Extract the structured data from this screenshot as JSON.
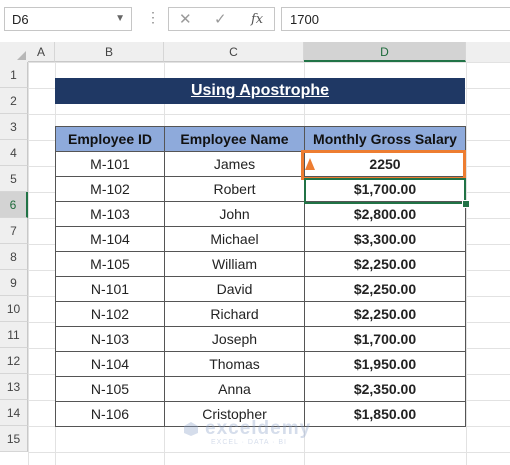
{
  "formula_bar": {
    "name_box": "D6",
    "cancel_icon": "close-icon",
    "enter_icon": "check-icon",
    "fx_label": "fx",
    "formula_value": "1700"
  },
  "columns": [
    "A",
    "B",
    "C",
    "D"
  ],
  "rows": [
    "1",
    "2",
    "3",
    "4",
    "5",
    "6",
    "7",
    "8",
    "9",
    "10",
    "11",
    "12",
    "13",
    "14",
    "15"
  ],
  "title": "Using Apostrophe",
  "table": {
    "headers": [
      "Employee ID",
      "Employee Name",
      "Monthly Gross Salary"
    ],
    "rows": [
      [
        "M-101",
        "James",
        "2250"
      ],
      [
        "M-102",
        "Robert",
        "$1,700.00"
      ],
      [
        "M-103",
        "John",
        "$2,800.00"
      ],
      [
        "M-104",
        "Michael",
        "$3,300.00"
      ],
      [
        "M-105",
        "William",
        "$2,250.00"
      ],
      [
        "N-101",
        "David",
        "$2,250.00"
      ],
      [
        "N-102",
        "Richard",
        "$2,250.00"
      ],
      [
        "N-103",
        "Joseph",
        "$1,700.00"
      ],
      [
        "N-104",
        "Thomas",
        "$1,950.00"
      ],
      [
        "N-105",
        "Anna",
        "$2,350.00"
      ],
      [
        "N-106",
        "Cristopher",
        "$1,850.00"
      ]
    ]
  },
  "watermark": {
    "brand": "exceldemy",
    "tagline": "EXCEL · DATA · BI"
  },
  "colors": {
    "title_bg": "#1f3864",
    "header_bg": "#8eaadb",
    "highlight": "#ed7d31",
    "selection": "#217346"
  }
}
